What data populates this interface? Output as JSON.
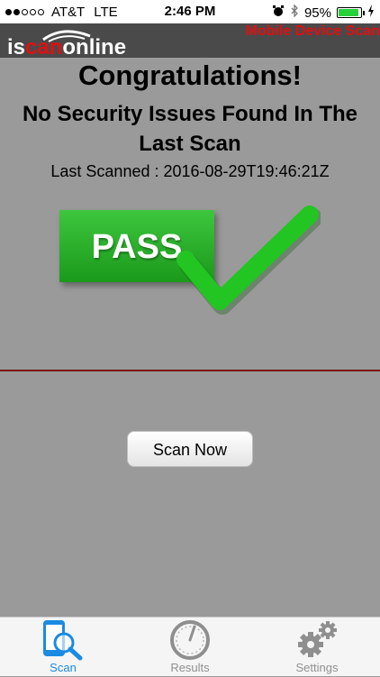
{
  "status_bar": {
    "carrier": "AT&T",
    "network": "LTE",
    "time": "2:46 PM",
    "battery": "95%",
    "battery_level": 0.95,
    "icons": [
      "alarm-icon",
      "bluetooth-icon",
      "charging-icon"
    ]
  },
  "header": {
    "logo_text": "iscanonline",
    "tagline": "Mobile Device Scan"
  },
  "main": {
    "title": "Congratulations!",
    "subtitle": "No Security Issues Found In The Last Scan",
    "last_scanned": "Last Scanned : 2016-08-29T19:46:21Z",
    "pass_label": "PASS",
    "scan_button": "Scan Now"
  },
  "tabs": [
    {
      "label": "Scan",
      "icon": "scan-phone-icon",
      "active": true
    },
    {
      "label": "Results",
      "icon": "gauge-icon",
      "active": false
    },
    {
      "label": "Settings",
      "icon": "gears-icon",
      "active": false
    }
  ],
  "colors": {
    "accent": "#1a8be0",
    "pass_green": "#2eb82e",
    "check_green": "#22c522",
    "header_red": "#e01010",
    "divider": "#7a1010"
  }
}
